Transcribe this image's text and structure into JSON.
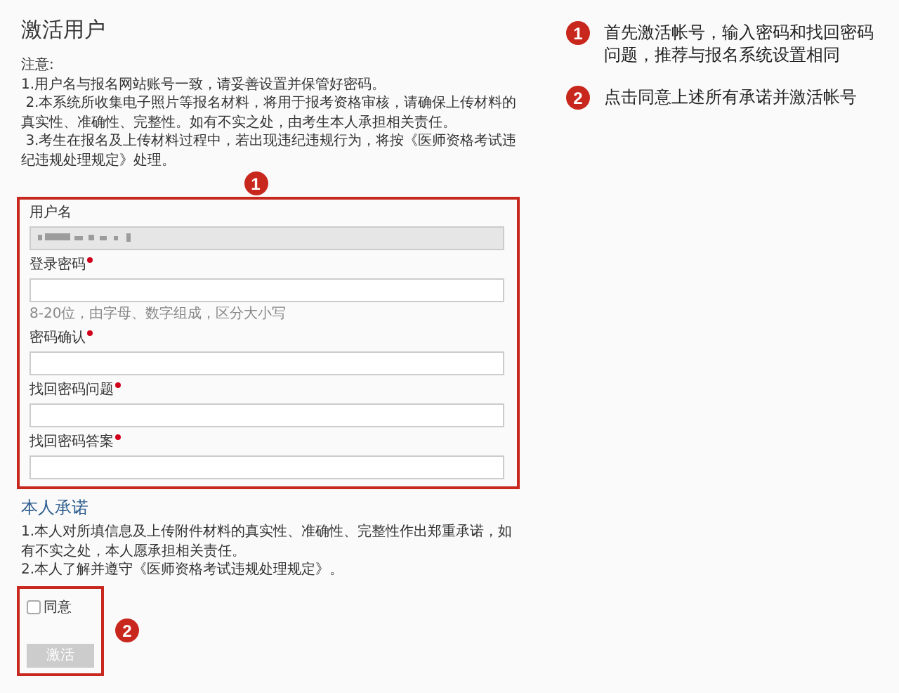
{
  "title": "激活用户",
  "notice": {
    "heading": "注意:",
    "items": [
      "1.用户名与报名网站账号一致，请妥善设置并保管好密码。",
      " 2.本系统所收集电子照片等报名材料，将用于报考资格审核，请确保上传材料的真实性、准确性、完整性。如有不实之处，由考生本人承担相关责任。",
      " 3.考生在报名及上传材料过程中，若出现违纪违规行为，将按《医师资格考试违纪违规处理规定》处理。"
    ]
  },
  "form_marker": "1",
  "fields": [
    {
      "label": "用户名",
      "required": false,
      "disabled": true
    },
    {
      "label": "登录密码",
      "required": true,
      "disabled": false,
      "hint": "8-20位，由字母、数字组成，区分大小写"
    },
    {
      "label": "密码确认",
      "required": true,
      "disabled": false
    },
    {
      "label": "找回密码问题",
      "required": true,
      "disabled": false
    },
    {
      "label": "找回密码答案",
      "required": true,
      "disabled": false
    }
  ],
  "pledge": {
    "heading": "本人承诺",
    "items": [
      "1.本人对所填信息及上传附件材料的真实性、准确性、完整性作出郑重承诺，如有不实之处，本人愿承担相关责任。",
      "2.本人了解并遵守《医师资格考试违规处理规定》。"
    ]
  },
  "agree": {
    "label": "同意",
    "checked": false
  },
  "submit": {
    "label": "激活",
    "disabled": true
  },
  "agree_marker": "2",
  "annotations": [
    {
      "number": "1",
      "text": "首先激活帐号，输入密码和找回密码问题，推荐与报名系统设置相同"
    },
    {
      "number": "2",
      "text": "点击同意上述所有承诺并激活帐号"
    }
  ]
}
